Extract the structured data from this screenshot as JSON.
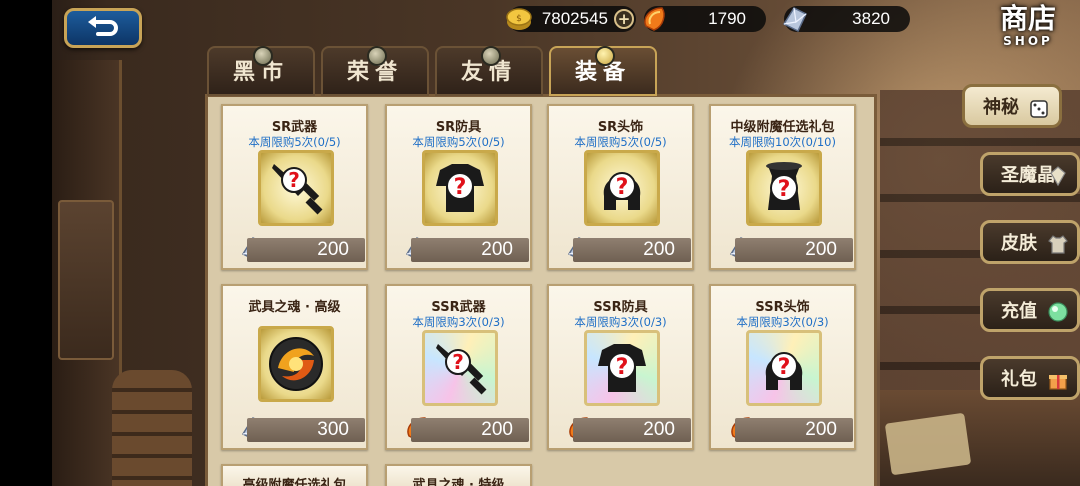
{
  "header": {
    "back_icon": "return-arrow-icon",
    "gold": "7802545",
    "ruby": "1790",
    "crystal": "3820",
    "shop_title": "商店",
    "shop_subtitle": "SHOP"
  },
  "tabs": [
    {
      "label": "黑市",
      "active": false
    },
    {
      "label": "荣誉",
      "active": false
    },
    {
      "label": "友情",
      "active": false
    },
    {
      "label": "装备",
      "active": true
    }
  ],
  "side_menu": [
    {
      "label": "神秘",
      "icon": "dice-icon",
      "active": true
    },
    {
      "label": "圣魔晶",
      "icon": "crystal-icon",
      "active": false
    },
    {
      "label": "皮肤",
      "icon": "shirt-icon",
      "active": false
    },
    {
      "label": "充值",
      "icon": "gem-icon",
      "active": false
    },
    {
      "label": "礼包",
      "icon": "gift-icon",
      "active": false
    }
  ],
  "items": [
    {
      "name": "SR武器",
      "limit": "本周限购5次(0/5)",
      "price": "200",
      "currency": "crystal",
      "icon": "sword-mystery-icon",
      "tier": "sr"
    },
    {
      "name": "SR防具",
      "limit": "本周限购5次(0/5)",
      "price": "200",
      "currency": "crystal",
      "icon": "armor-mystery-icon",
      "tier": "sr"
    },
    {
      "name": "SR头饰",
      "limit": "本周限购5次(0/5)",
      "price": "200",
      "currency": "crystal",
      "icon": "helmet-mystery-icon",
      "tier": "sr"
    },
    {
      "name": "中级附魔任选礼包",
      "limit": "本周限购10次(0/10)",
      "price": "200",
      "currency": "crystal",
      "icon": "scroll-mystery-icon",
      "tier": "sr"
    },
    {
      "name": "武具之魂 · 高级",
      "limit": "",
      "price": "300",
      "currency": "crystal",
      "icon": "soul-orb-icon",
      "tier": "sr"
    },
    {
      "name": "SSR武器",
      "limit": "本周限购3次(0/3)",
      "price": "200",
      "currency": "ruby",
      "icon": "sword-mystery-icon",
      "tier": "ssr"
    },
    {
      "name": "SSR防具",
      "limit": "本周限购3次(0/3)",
      "price": "200",
      "currency": "ruby",
      "icon": "armor-mystery-icon",
      "tier": "ssr"
    },
    {
      "name": "SSR头饰",
      "limit": "本周限购3次(0/3)",
      "price": "200",
      "currency": "ruby",
      "icon": "helmet-mystery-icon",
      "tier": "ssr"
    },
    {
      "name": "高级附魔任选礼包",
      "limit": "",
      "price": "",
      "currency": "",
      "icon": "",
      "tier": "sr"
    },
    {
      "name": "武具之魂 · 特级",
      "limit": "",
      "price": "",
      "currency": "",
      "icon": "",
      "tier": "sr"
    }
  ]
}
